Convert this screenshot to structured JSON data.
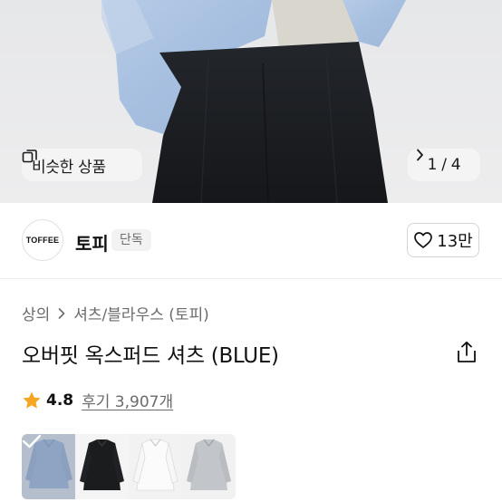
{
  "hero": {
    "similar_label": "비슷한 상품",
    "page_indicator": "1 / 4"
  },
  "brand": {
    "logo_text": "TOFFEE",
    "name": "토피",
    "badge": "단독",
    "like_count": "13만"
  },
  "breadcrumb": {
    "category": "상의",
    "subcategory": "셔츠/블라우스 (토피)"
  },
  "product": {
    "title": "오버핏 옥스퍼드 셔츠 (BLUE)"
  },
  "rating": {
    "score": "4.8",
    "reviews": "후기 3,907개"
  },
  "colors": {
    "star": "#f5a623",
    "selected_overlay": "#8ea9c9"
  },
  "thumbnails": [
    {
      "name": "blue",
      "selected": true
    },
    {
      "name": "black",
      "selected": false
    },
    {
      "name": "white",
      "selected": false
    },
    {
      "name": "gray",
      "selected": false
    }
  ]
}
